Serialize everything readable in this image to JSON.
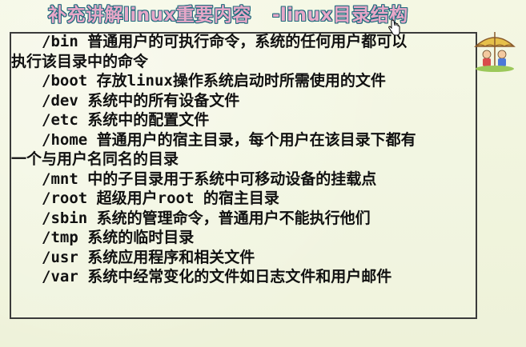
{
  "slide": {
    "title_main": "补充讲解linux重要内容",
    "title_sub": "-linux目录结构",
    "lines": [
      "/bin 普通用户的可执行命令，系统的任何用户都可以",
      "执行该目录中的命令",
      "/boot 存放linux操作系统启动时所需使用的文件",
      "/dev 系统中的所有设备文件",
      "/etc 系统中的配置文件",
      "/home 普通用户的宿主目录，每个用户在该目录下都有",
      "一个与用户名同名的目录",
      "/mnt 中的子目录用于系统中可移动设备的挂载点",
      "/root 超级用户root 的宿主目录",
      "/sbin  系统的管理命令，普通用户不能执行他们",
      "/tmp 系统的临时目录",
      "/usr 系统应用程序和相关文件",
      "/var 系统中经常变化的文件如日志文件和用户邮件"
    ]
  },
  "colors": {
    "title_fill": "#e7a7c8",
    "title_outline": "#1f6b7d",
    "text": "#111111",
    "background": "#f1f5df"
  },
  "icons": {
    "illustration": "children-under-umbrella-icon",
    "cursor": "hand-cursor-icon"
  }
}
